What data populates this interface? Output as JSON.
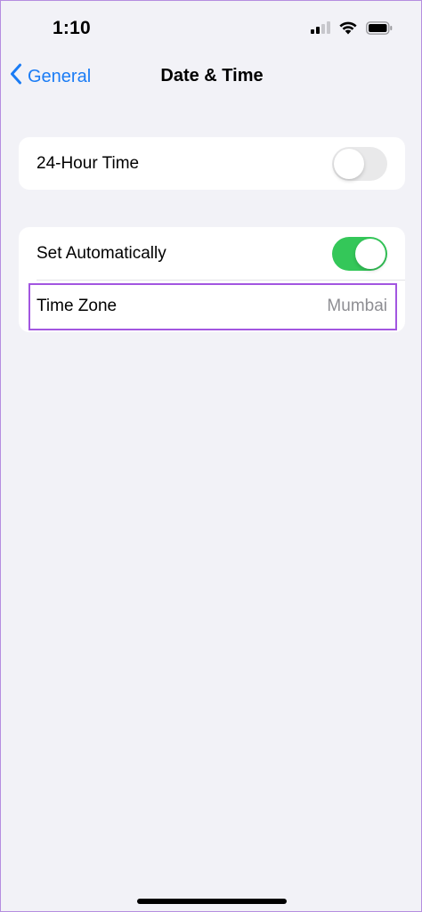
{
  "status_bar": {
    "time": "1:10",
    "icons": [
      "cellular-signal-icon",
      "wifi-icon",
      "battery-icon"
    ]
  },
  "nav": {
    "back_label": "General",
    "title": "Date & Time"
  },
  "groups": [
    {
      "rows": [
        {
          "label": "24-Hour Time",
          "type": "toggle",
          "on": false
        }
      ]
    },
    {
      "rows": [
        {
          "label": "Set Automatically",
          "type": "toggle",
          "on": true
        },
        {
          "label": "Time Zone",
          "type": "value",
          "value": "Mumbai"
        }
      ]
    }
  ],
  "colors": {
    "accent": "#1a7cf5",
    "toggle_on": "#34c759",
    "toggle_off": "#e9e9ea",
    "highlight": "#a256e0",
    "background": "#f2f2f7"
  }
}
